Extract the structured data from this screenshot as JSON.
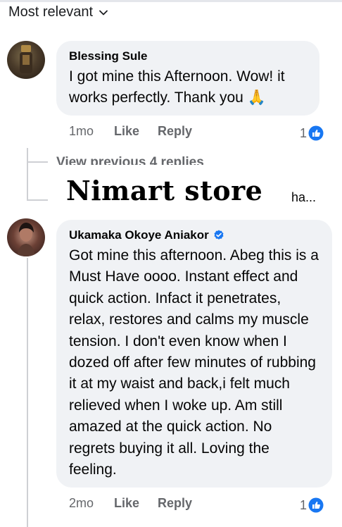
{
  "sort": {
    "label": "Most relevant"
  },
  "comments": [
    {
      "author": "Blessing Sule",
      "text": "I got mine this Afternoon. Wow! it works perfectly. Thank you 🙏",
      "time": "1mo",
      "like_label": "Like",
      "reply_label": "Reply",
      "reaction_count": "1"
    },
    {
      "author": "Ukamaka Okoye Aniakor",
      "text": "Got mine this afternoon. Abeg this is a Must Have oooo. Instant effect and quick action. Infact it penetrates, relax, restores and calms my muscle tension. I don't even know when I dozed off after few minutes of rubbing it at my waist and back,i felt much relieved when I woke up. Am still amazed at the quick action. No regrets buying it all. Loving the feeling.",
      "time": "2mo",
      "like_label": "Like",
      "reply_label": "Reply",
      "reaction_count": "1"
    }
  ],
  "thread": {
    "view_previous": "View previous 4 replies",
    "reply_snippet": "ha..."
  },
  "watermark": "Nimart store",
  "colors": {
    "like_blue": "#1877f2",
    "bubble_bg": "#f0f2f5",
    "secondary_text": "#65676b"
  }
}
